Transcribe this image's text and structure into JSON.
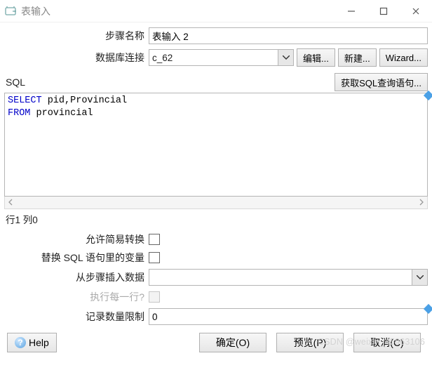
{
  "window": {
    "title": "表输入",
    "btn_min": "minimize",
    "btn_max": "maximize",
    "btn_close": "close"
  },
  "form": {
    "step_name_label": "步骤名称",
    "step_name_value": "表输入 2",
    "db_conn_label": "数据库连接",
    "db_conn_value": "c_62",
    "btn_edit": "编辑...",
    "btn_new": "新建...",
    "btn_wizard": "Wizard..."
  },
  "sql": {
    "label": "SQL",
    "btn_get_sql": "获取SQL查询语句...",
    "kw_select": "SELECT",
    "kw_from": "FROM",
    "cols": " pid,Provincial",
    "table": " provincial"
  },
  "status": {
    "line": "行1 列0"
  },
  "opts": {
    "allow_simple_label": "允许简易转换",
    "replace_vars_label": "替换 SQL 语句里的变量",
    "insert_from_step_label": "从步骤插入数据",
    "insert_from_step_value": "",
    "execute_each_row_label": "执行每一行?",
    "record_limit_label": "记录数量限制",
    "record_limit_value": "0"
  },
  "bottom": {
    "help": "Help",
    "ok": "确定(O)",
    "preview": "预览(P)",
    "cancel": "取消(C)"
  },
  "watermark": "CSDN @weixin_45963106"
}
